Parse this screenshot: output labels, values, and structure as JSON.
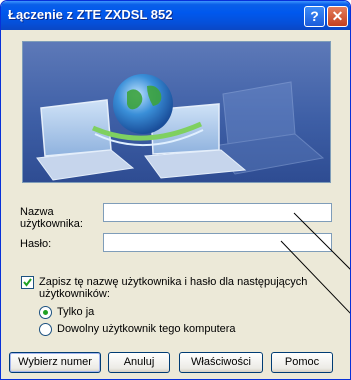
{
  "window": {
    "title": "Łączenie z ZTE ZXDSL 852",
    "help_glyph": "?",
    "close_glyph": "✕"
  },
  "form": {
    "username_label_line1": "Nazwa",
    "username_label_line2": "użytkownika:",
    "username_value": "",
    "password_label": "Hasło:",
    "password_value": "",
    "save_checkbox_label_line1": "Zapisz tę nazwę użytkownika i hasło dla następujących",
    "save_checkbox_label_line2": "użytkowników:",
    "save_checked": true,
    "radio_only_me": "Tylko ja",
    "radio_anyone": "Dowolny użytkownik tego komputera",
    "selected_radio": "only_me"
  },
  "buttons": {
    "dial": "Wybierz numer",
    "cancel": "Anuluj",
    "properties": "Właściwości",
    "help": "Pomoc"
  }
}
